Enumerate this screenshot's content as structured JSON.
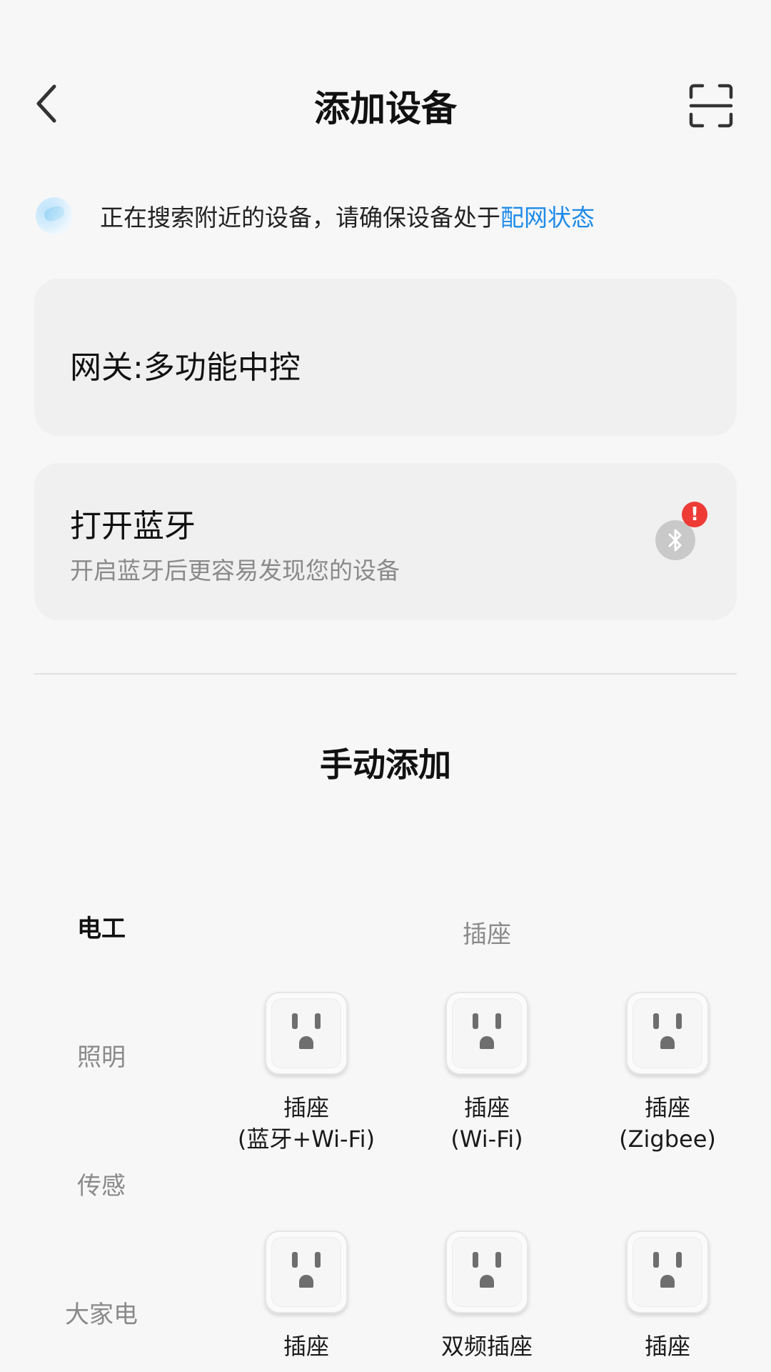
{
  "header": {
    "title": "添加设备"
  },
  "search": {
    "text": "正在搜索附近的设备，请确保设备处于",
    "link": "配网状态"
  },
  "gateway_card": {
    "label": "网关:多功能中控"
  },
  "bluetooth_card": {
    "label": "打开蓝牙",
    "subtitle": "开启蓝牙后更容易发现您的设备",
    "badge": "!"
  },
  "manual": {
    "title": "手动添加"
  },
  "categories": [
    {
      "label": "电工",
      "active": true
    },
    {
      "label": "照明",
      "active": false
    },
    {
      "label": "传感",
      "active": false
    },
    {
      "label": "大家电",
      "active": false
    }
  ],
  "section": {
    "title": "插座"
  },
  "devices": [
    {
      "name": "插座",
      "sub": "(蓝牙+Wi-Fi)"
    },
    {
      "name": "插座",
      "sub": "(Wi-Fi)"
    },
    {
      "name": "插座",
      "sub": "(Zigbee)"
    },
    {
      "name": "插座",
      "sub": ""
    },
    {
      "name": "双频插座",
      "sub": ""
    },
    {
      "name": "插座",
      "sub": ""
    }
  ],
  "colors": {
    "accent": "#1e8be8",
    "alert": "#ee3b36",
    "card_bg": "#f0f0f0",
    "page_bg": "#f7f7f7"
  },
  "icons": [
    "back-chevron-icon",
    "scan-frame-icon",
    "bluetooth-icon",
    "socket-icon"
  ]
}
